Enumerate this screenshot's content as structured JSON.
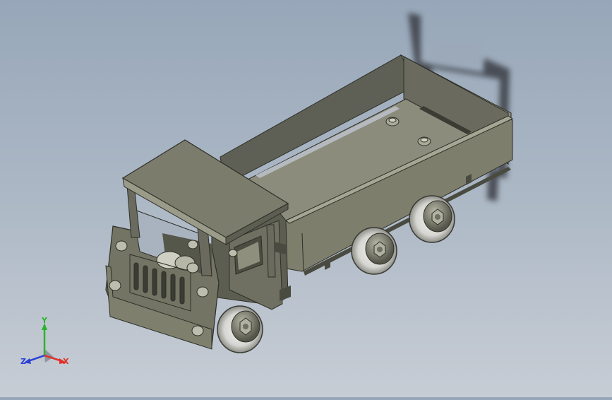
{
  "viewport": {
    "background_top": "#97a7b9",
    "background_bottom": "#c7cdd5",
    "body_color": "#6f7061",
    "body_highlight": "#9a9b88",
    "body_shadow": "#4a4b40",
    "tire_color": "#d8d8d4",
    "shadow_color": "#3a3d44"
  },
  "triad": {
    "x_label": "X",
    "y_label": "Y",
    "z_label": "Z",
    "x_color": "#e0302a",
    "y_color": "#2bb52b",
    "z_color": "#2a3fd6"
  }
}
